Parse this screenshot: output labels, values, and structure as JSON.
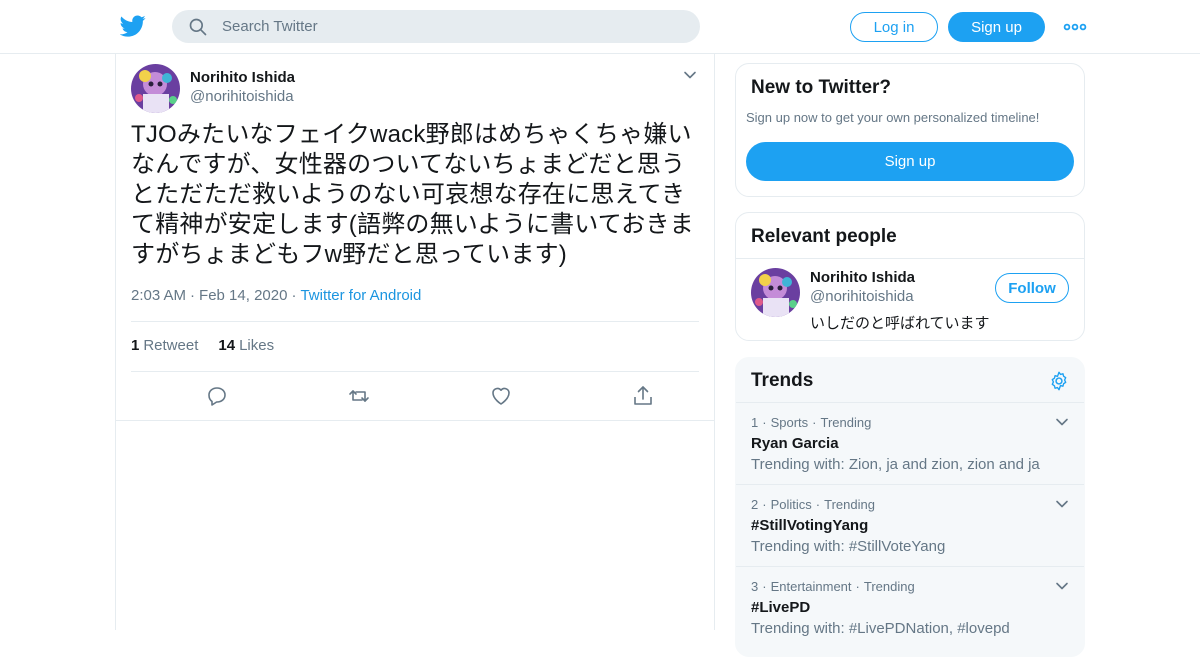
{
  "header": {
    "search_placeholder": "Search Twitter",
    "login_label": "Log in",
    "signup_label": "Sign up",
    "more_icon": "more-dots-icon"
  },
  "tweet": {
    "author_name": "Norihito Ishida",
    "author_handle": "@norihitoishida",
    "text": "TJOみたいなフェイクwack野郎はめちゃくちゃ嫌いなんですが、女性器のついてないちょまどだと思うとただただ救いようのない可哀想な存在に思えてきて精神が安定します(語弊の無いように書いておきますがちょまどもフw野だと思っています)",
    "time": "2:03 AM",
    "date": "Feb 14, 2020",
    "source": "Twitter for Android",
    "retweets": "1",
    "retweets_label": "Retweet",
    "likes": "14",
    "likes_label": "Likes"
  },
  "new_to_twitter": {
    "title": "New to Twitter?",
    "subtitle": "Sign up now to get your own personalized timeline!",
    "signup_label": "Sign up"
  },
  "relevant_people": {
    "title": "Relevant people",
    "name": "Norihito Ishida",
    "handle": "@norihitoishida",
    "bio": "いしだのと呼ばれています",
    "follow_label": "Follow"
  },
  "trends": {
    "title": "Trends",
    "items": [
      {
        "rank": "1",
        "category": "Sports",
        "status": "Trending",
        "name": "Ryan Garcia",
        "with": "Trending with: Zion, ja and zion, zion and ja"
      },
      {
        "rank": "2",
        "category": "Politics",
        "status": "Trending",
        "name": "#StillVotingYang",
        "with": "Trending with: #StillVoteYang"
      },
      {
        "rank": "3",
        "category": "Entertainment",
        "status": "Trending",
        "name": "#LivePD",
        "with": "Trending with: #LivePDNation, #lovepd"
      }
    ]
  },
  "colors": {
    "brand": "#1da1f2",
    "link": "#1b95e0",
    "secondary_text": "#657786",
    "border": "#e6ecf0"
  }
}
